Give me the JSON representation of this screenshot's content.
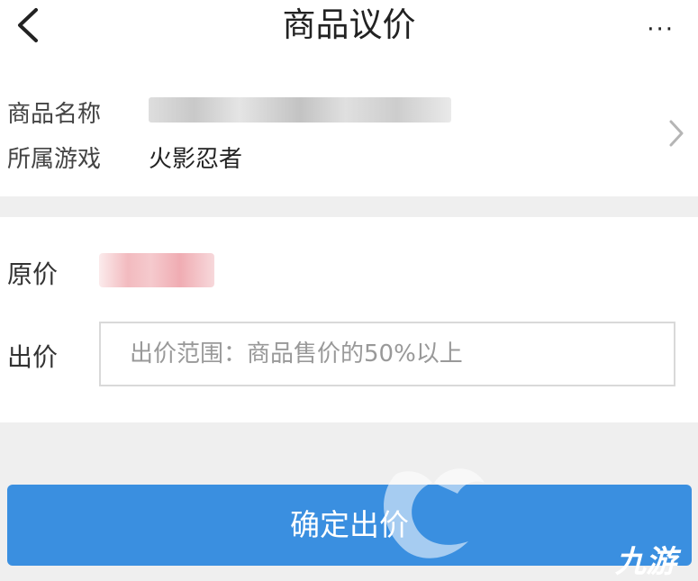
{
  "header": {
    "title": "商品议价",
    "more_label": "···"
  },
  "goods": {
    "name_label": "商品名称",
    "game_label": "所属游戏",
    "game_value": "火影忍者"
  },
  "bid": {
    "original_price_label": "原价",
    "bid_label": "出价",
    "bid_placeholder": "出价范围：商品售价的50%以上"
  },
  "footer": {
    "submit_label": "确定出价"
  },
  "watermark": {
    "text": "九游"
  },
  "colors": {
    "primary": "#3a8fe0",
    "background": "#efefef",
    "price_blur": "#f1b3b8"
  }
}
